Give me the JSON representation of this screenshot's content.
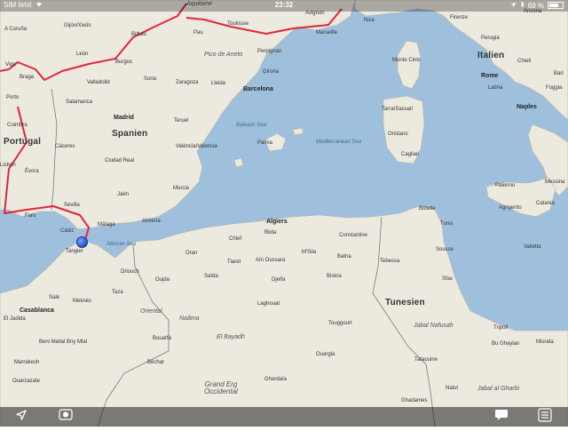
{
  "status_bar": {
    "carrier": "SIM fehlt",
    "wifi_icon": "wifi-icon",
    "time": "23:32",
    "location_icon": "location-arrow-icon",
    "bluetooth_icon": "bluetooth-icon",
    "battery": "69 %"
  },
  "map": {
    "labels": {
      "countries": [
        {
          "text": "Portugal"
        },
        {
          "text": "Spanien"
        },
        {
          "text": "Italien"
        },
        {
          "text": "Tunesien"
        }
      ],
      "seas": [
        {
          "text": "Balearic Sea"
        },
        {
          "text": "Mediterranean Sea"
        },
        {
          "text": "Alboran Sea"
        }
      ],
      "regions": [
        {
          "text": "Aquitaine"
        },
        {
          "text": "Pico de Aneto"
        },
        {
          "text": "Oriental"
        },
        {
          "text": "Naâma"
        },
        {
          "text": "El Bayadh"
        },
        {
          "text": "Grand Erg\nOccidental"
        },
        {
          "text": "Jabal Nafusah"
        },
        {
          "text": "Jabal al Gharbi"
        }
      ],
      "cities": [
        {
          "text": "Madrid"
        },
        {
          "text": "Barcelona"
        },
        {
          "text": "Rome"
        },
        {
          "text": "Naples"
        },
        {
          "text": "Algiers"
        },
        {
          "text": "A Coruña"
        },
        {
          "text": "Gijón/Xixón"
        },
        {
          "text": "Bilbao"
        },
        {
          "text": "Pau"
        },
        {
          "text": "Toulouse"
        },
        {
          "text": "Avignon"
        },
        {
          "text": "Nice"
        },
        {
          "text": "Marseille"
        },
        {
          "text": "Firenze"
        },
        {
          "text": "Perugia"
        },
        {
          "text": "Ancona"
        },
        {
          "text": "Chieti"
        },
        {
          "text": "Foggia"
        },
        {
          "text": "Bari"
        },
        {
          "text": "Latina"
        },
        {
          "text": "Vigo"
        },
        {
          "text": "León"
        },
        {
          "text": "Burgos"
        },
        {
          "text": "Braga"
        },
        {
          "text": "Porto"
        },
        {
          "text": "Valladolid"
        },
        {
          "text": "Soria"
        },
        {
          "text": "Zaragoza"
        },
        {
          "text": "Lleida"
        },
        {
          "text": "Perpignan"
        },
        {
          "text": "Girona"
        },
        {
          "text": "Monte Cinto"
        },
        {
          "text": "Salamanca"
        },
        {
          "text": "Coimbra"
        },
        {
          "text": "Teruel"
        },
        {
          "text": "Palma"
        },
        {
          "text": "Tarra/Sassari"
        },
        {
          "text": "Oristano"
        },
        {
          "text": "Cagliari"
        },
        {
          "text": "València/Valencia"
        },
        {
          "text": "Cáceres"
        },
        {
          "text": "Ciudad Real"
        },
        {
          "text": "Évora"
        },
        {
          "text": "Lisbon"
        },
        {
          "text": "Jaén"
        },
        {
          "text": "Murcia"
        },
        {
          "text": "Sevilla"
        },
        {
          "text": "Faro"
        },
        {
          "text": "Cádiz"
        },
        {
          "text": "Málaga"
        },
        {
          "text": "Almería"
        },
        {
          "text": "Palermo"
        },
        {
          "text": "Messina"
        },
        {
          "text": "Agrigento"
        },
        {
          "text": "Catania"
        },
        {
          "text": "Valletta"
        },
        {
          "text": "Bizerte"
        },
        {
          "text": "Tunis"
        },
        {
          "text": "Sousse"
        },
        {
          "text": "Sfax"
        },
        {
          "text": "Blida"
        },
        {
          "text": "Constantine"
        },
        {
          "text": "Chlef"
        },
        {
          "text": "Oran"
        },
        {
          "text": "Tiaret"
        },
        {
          "text": "Aïn Oussara"
        },
        {
          "text": "M'Sila"
        },
        {
          "text": "Batna"
        },
        {
          "text": "Tebessa"
        },
        {
          "text": "Tangier"
        },
        {
          "text": "Saïda"
        },
        {
          "text": "Djelfa"
        },
        {
          "text": "Biskra"
        },
        {
          "text": "Driouch"
        },
        {
          "text": "Oujda"
        },
        {
          "text": "Taza"
        },
        {
          "text": "Salé"
        },
        {
          "text": "Meknès"
        },
        {
          "text": "Laghouat"
        },
        {
          "text": "Casablanca"
        },
        {
          "text": "El Jadida"
        },
        {
          "text": "Touggourt"
        },
        {
          "text": "Tripoli"
        },
        {
          "text": "Bu Ghaylan"
        },
        {
          "text": "Misrata"
        },
        {
          "text": "Beni Mellal Bny Mlal"
        },
        {
          "text": "Bouarfa"
        },
        {
          "text": "Marrakesh"
        },
        {
          "text": "Béchar"
        },
        {
          "text": "Ouargla"
        },
        {
          "text": "Tataouine"
        },
        {
          "text": "Ouarzazate"
        },
        {
          "text": "Ghardaïa"
        },
        {
          "text": "Nalut"
        },
        {
          "text": "Ghadames"
        }
      ]
    },
    "pin_icon": "location-pin-icon"
  },
  "toolbar": {
    "location_button_icon": "location-arrow-icon",
    "record_button_icon": "record-icon",
    "comment_button_icon": "speech-bubble-icon",
    "list_button_icon": "list-icon"
  },
  "colors": {
    "water": "#9fc0dd",
    "land": "#ece9df",
    "route": "#e0263b",
    "pin": "#2f5fd0"
  }
}
